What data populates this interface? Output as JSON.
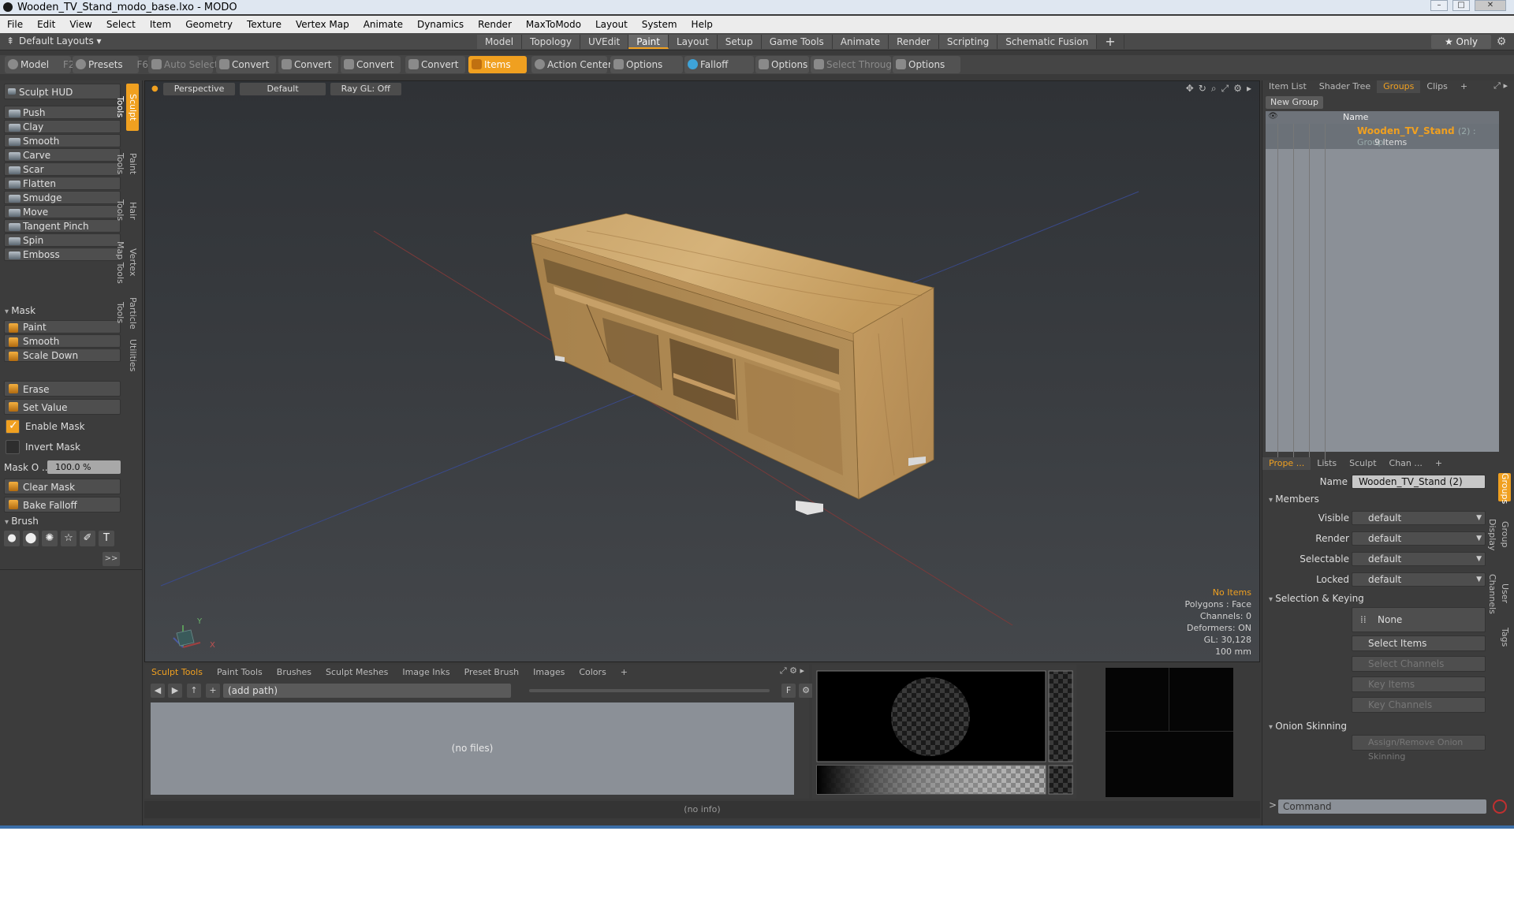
{
  "window": {
    "title": "Wooden_TV_Stand_modo_base.lxo - MODO"
  },
  "menu": [
    "File",
    "Edit",
    "View",
    "Select",
    "Item",
    "Geometry",
    "Texture",
    "Vertex Map",
    "Animate",
    "Dynamics",
    "Render",
    "MaxToModo",
    "Layout",
    "System",
    "Help"
  ],
  "layouts": {
    "dropdown": "Default Layouts ▾",
    "tabs": [
      "Model",
      "Topology",
      "UVEdit",
      "Paint",
      "Layout",
      "Setup",
      "Game Tools",
      "Animate",
      "Render",
      "Scripting",
      "Schematic Fusion"
    ],
    "active_tab": "Paint",
    "only_label": "★  Only"
  },
  "toolbar": {
    "model": "Model",
    "model_key": "F2",
    "presets": "Presets",
    "presets_key": "F6",
    "auto_select": "Auto Select",
    "convert": "Convert",
    "items": "Items",
    "action_center": "Action Center",
    "options": "Options",
    "falloff": "Falloff",
    "select_through": "Select Through"
  },
  "left": {
    "hud": "Sculpt HUD",
    "tools": [
      "Push",
      "Clay",
      "Smooth",
      "Carve",
      "Scar",
      "Flatten",
      "Smudge",
      "Move",
      "Tangent Pinch",
      "Spin",
      "Emboss"
    ],
    "mask_section": "Mask",
    "mask_tools": [
      "Paint",
      "Smooth",
      "Scale Down"
    ],
    "erase": "Erase",
    "set_value": "Set Value",
    "enable_mask": "Enable Mask",
    "invert_mask": "Invert Mask",
    "mask_opacity_label": "Mask O ...",
    "mask_opacity_value": "100.0 %",
    "clear_mask": "Clear Mask",
    "bake_falloff": "Bake Falloff",
    "brush_section": "Brush",
    "expand": ">>",
    "vtabs": [
      "Sculpt Tools",
      "Paint Tools",
      "Hair Tools",
      "Vertex Map Tools",
      "Particle Tools",
      "Utilities"
    ]
  },
  "viewport": {
    "view": "Perspective",
    "shading": "Default",
    "raygl": "Ray GL: Off",
    "info": {
      "items": "No Items",
      "polygons": "Polygons : Face",
      "channels": "Channels: 0",
      "deformers": "Deformers: ON",
      "gl": "GL: 30,128",
      "scale": "100 mm"
    },
    "axis_y": "Y",
    "axis_x": "X"
  },
  "browser": {
    "tabs": [
      "Sculpt Tools",
      "Paint Tools",
      "Brushes",
      "Sculpt Meshes",
      "Image Inks",
      "Preset Brush",
      "Images",
      "Colors",
      "+"
    ],
    "active_tab": "Sculpt Tools",
    "path": "(add path)",
    "files": "(no files)",
    "f_label": "F"
  },
  "status": {
    "info": "(no info)"
  },
  "right": {
    "tabs": [
      "Item List",
      "Shader Tree",
      "Groups",
      "Clips",
      "+"
    ],
    "active_tab": "Groups",
    "new_group": "New Group",
    "col_name": "Name",
    "group_name": "Wooden_TV_Stand",
    "group_suffix": "(2) : Group",
    "group_items": "9 Items",
    "prop_tabs": [
      "Prope ...",
      "Lists",
      "Sculpt",
      "Chan ...",
      "+"
    ],
    "prop_active": "Prope ...",
    "name_label": "Name",
    "name_value": "Wooden_TV_Stand (2)",
    "members": "Members",
    "visible_label": "Visible",
    "visible_value": "default",
    "render_label": "Render",
    "render_value": "default",
    "selectable_label": "Selectable",
    "selectable_value": "default",
    "locked_label": "Locked",
    "locked_value": "default",
    "sel_keying": "Selection & Keying",
    "none": "None",
    "select_items": "Select Items",
    "select_channels": "Select Channels",
    "key_items": "Key Items",
    "key_channels": "Key Channels",
    "onion": "Onion Skinning",
    "assign_onion": "Assign/Remove Onion Skinning",
    "vtabs": [
      "Groups",
      "Group Display",
      "User Channels",
      "Tags"
    ],
    "command_placeholder": "Command",
    "command_prompt": ">"
  },
  "colors": {
    "accent": "#f0a020",
    "panel": "#3c3c3c",
    "wood": "#c49a60"
  }
}
